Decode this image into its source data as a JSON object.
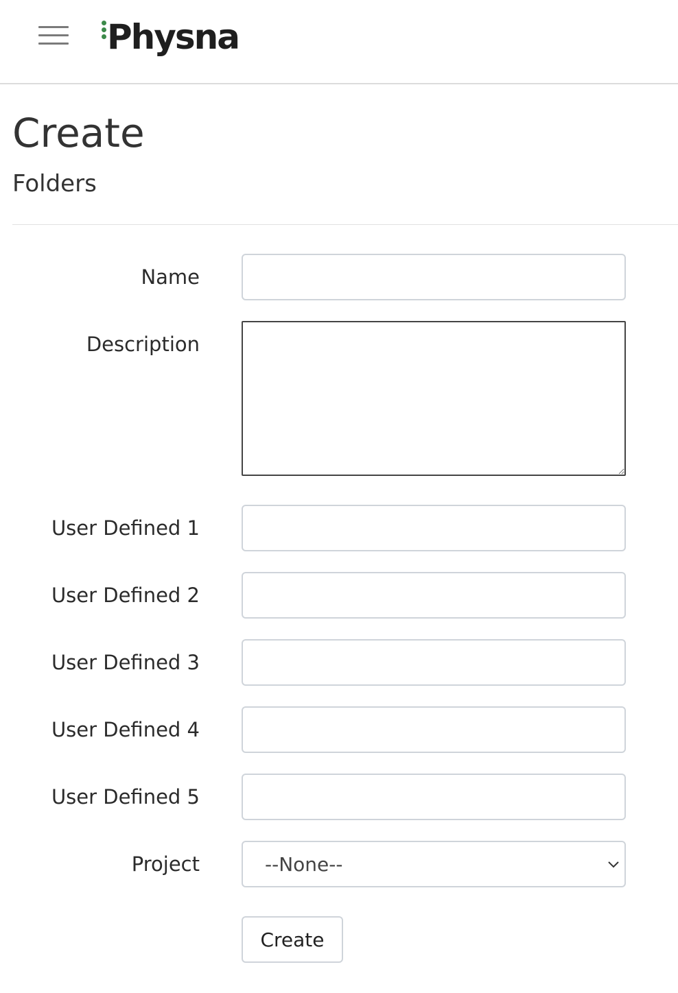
{
  "brand": {
    "name": "Physna"
  },
  "page": {
    "title": "Create",
    "subtitle": "Folders"
  },
  "form": {
    "name_label": "Name",
    "name_value": "",
    "description_label": "Description",
    "description_value": "",
    "ud1_label": "User Defined 1",
    "ud1_value": "",
    "ud2_label": "User Defined 2",
    "ud2_value": "",
    "ud3_label": "User Defined 3",
    "ud3_value": "",
    "ud4_label": "User Defined 4",
    "ud4_value": "",
    "ud5_label": "User Defined 5",
    "ud5_value": "",
    "project_label": "Project",
    "project_selected": "--None--",
    "submit_label": "Create"
  },
  "icons": {
    "menu": "hamburger-menu-icon",
    "select_arrow": "chevron-down-icon",
    "resize": "resize-handle-icon"
  },
  "colors": {
    "brand_accent": "#3c8a4a",
    "text": "#2b2b2b",
    "border": "#cfd4da"
  }
}
